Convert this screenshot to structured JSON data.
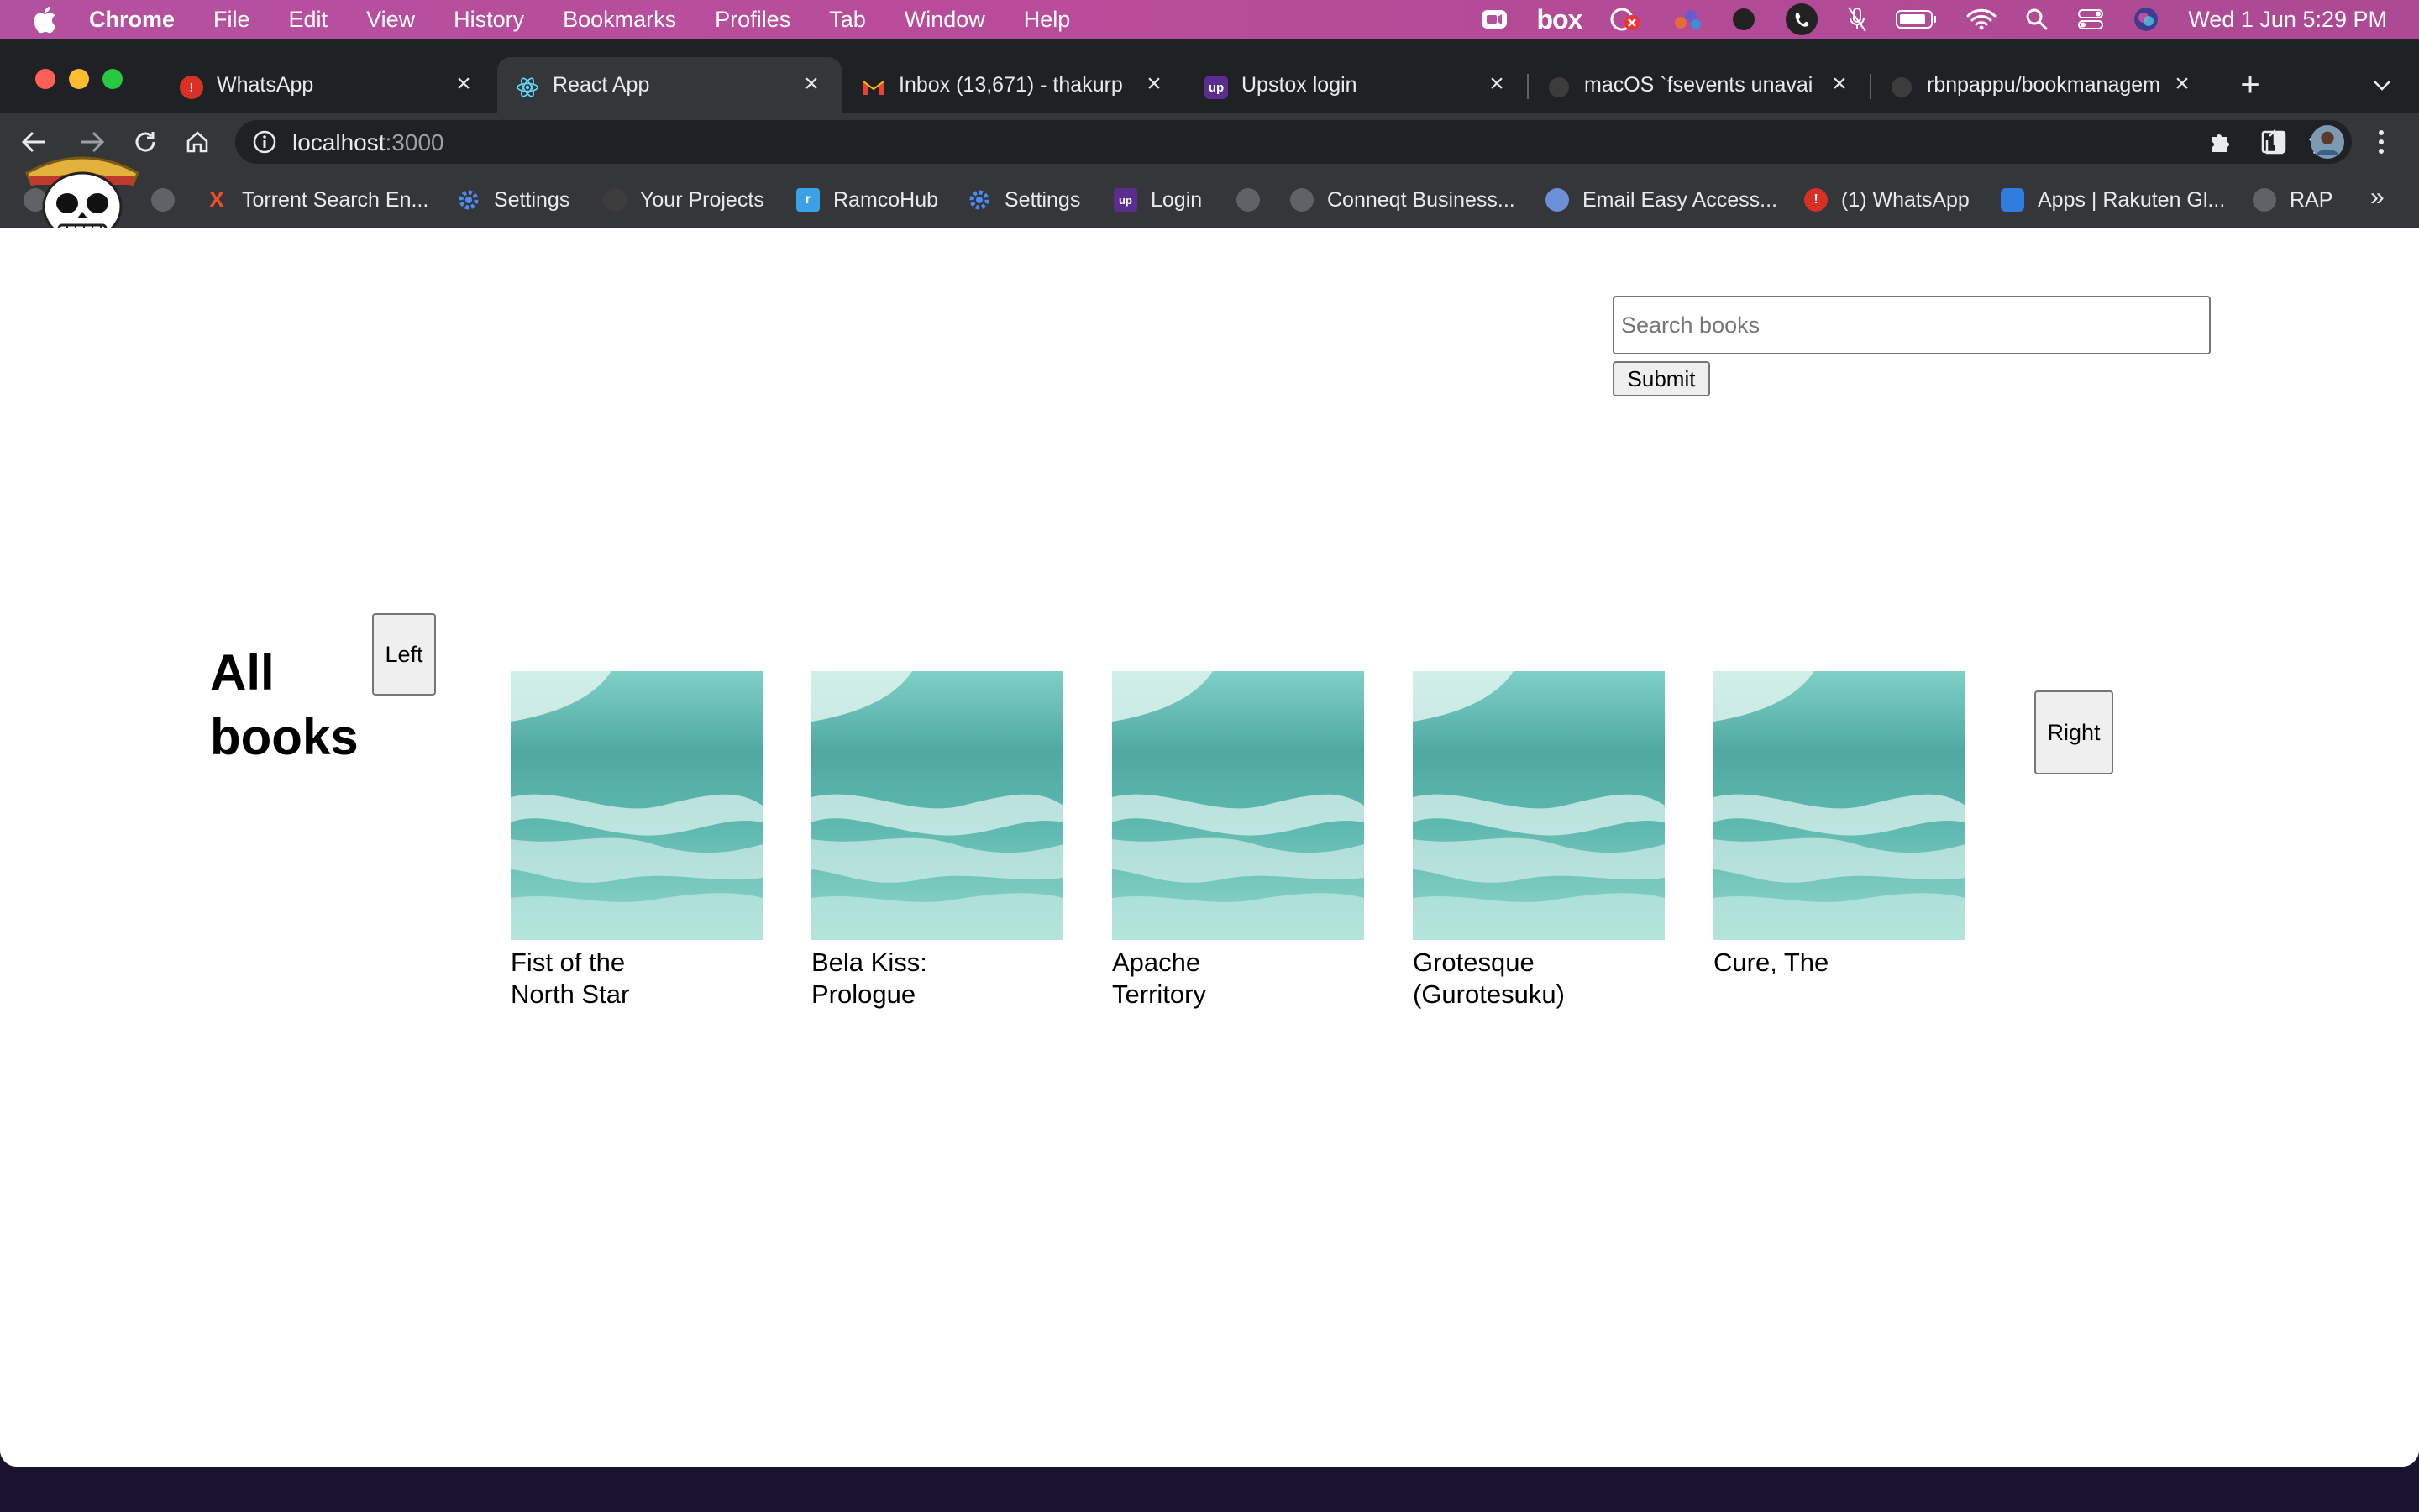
{
  "menubar": {
    "app_name": "Chrome",
    "menus": [
      "File",
      "Edit",
      "View",
      "History",
      "Bookmarks",
      "Profiles",
      "Tab",
      "Window",
      "Help"
    ],
    "status_icons": [
      "zoom-icon",
      "box-logo-icon",
      "chrome-remote-icon",
      "sparkle-icon",
      "dark-circle-icon",
      "viber-icon",
      "mic-off-icon",
      "battery-icon",
      "wifi-icon",
      "spotlight-search-icon",
      "control-center-icon",
      "siri-icon"
    ],
    "box_label": "box",
    "clock": "Wed 1 Jun  5:29 PM"
  },
  "browser": {
    "tabs": [
      {
        "title": "WhatsApp",
        "active": false
      },
      {
        "title": "React App",
        "active": true
      },
      {
        "title": "Inbox (13,671) - thakurp",
        "active": false
      },
      {
        "title": "Upstox login",
        "active": false
      },
      {
        "title": "macOS `fsevents unavai",
        "active": false
      },
      {
        "title": "rbnpappu/bookmanagem",
        "active": false
      }
    ],
    "new_tab_label": "+",
    "url_host": "localhost",
    "url_port": ":3000",
    "bookmarks": [
      {
        "label": "Torrent Search En...",
        "icon": "x-icon"
      },
      {
        "label": "Settings",
        "icon": "gear-icon"
      },
      {
        "label": "Your Projects",
        "icon": "github-icon"
      },
      {
        "label": "RamcoHub",
        "icon": "ramco-icon"
      },
      {
        "label": "Settings",
        "icon": "gear-icon"
      },
      {
        "label": "Login",
        "icon": "upstox-icon"
      },
      {
        "label": "Conneqt Business...",
        "icon": "globe-icon"
      },
      {
        "label": "Email Easy Access...",
        "icon": "email-icon"
      },
      {
        "label": "(1) WhatsApp",
        "icon": "alert-icon"
      },
      {
        "label": "Apps | Rakuten Gl...",
        "icon": "rakuten-icon"
      },
      {
        "label": "RAP",
        "icon": "globe-icon"
      }
    ],
    "bookmarks_overflow": "»"
  },
  "page": {
    "search": {
      "placeholder": "Search books",
      "value": ""
    },
    "submit_label": "Submit",
    "heading": "All books",
    "left_label": "Left",
    "right_label": "Right",
    "books": [
      {
        "title": "Fist of the North Star"
      },
      {
        "title": "Bela Kiss: Prologue"
      },
      {
        "title": "Apache Territory"
      },
      {
        "title": "Grotesque (Gurotesuku)"
      },
      {
        "title": "Cure, The"
      }
    ]
  },
  "colors": {
    "menubar": "#b4519f",
    "tabstrip": "#202124",
    "toolbar": "#35363a",
    "cover_water": "#5fb8ad"
  }
}
